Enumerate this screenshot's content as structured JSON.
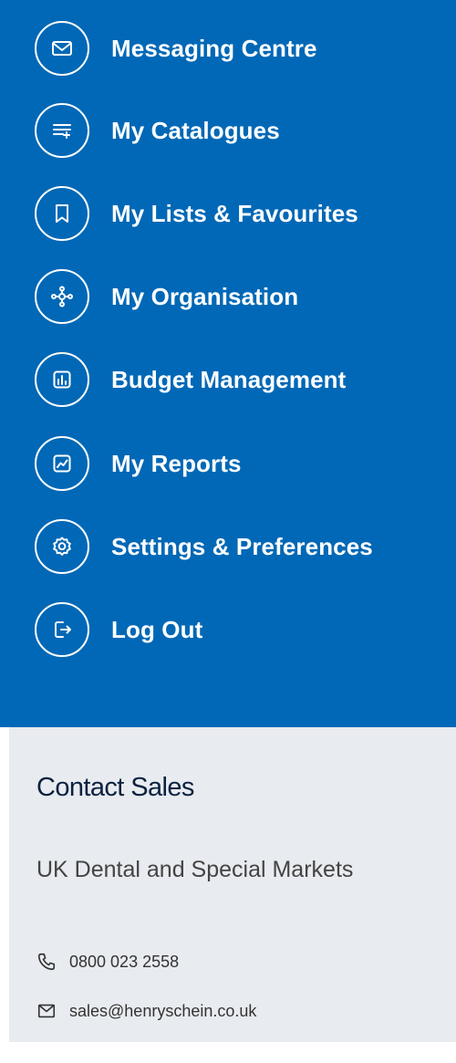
{
  "menu": {
    "background": "#0068b6",
    "items": [
      {
        "label": "Messaging Centre",
        "icon": "envelope-icon"
      },
      {
        "label": "My Catalogues",
        "icon": "catalogue-list-icon"
      },
      {
        "label": "My Lists & Favourites",
        "icon": "bookmark-icon"
      },
      {
        "label": "My Organisation",
        "icon": "organisation-network-icon"
      },
      {
        "label": "Budget Management",
        "icon": "bar-chart-icon"
      },
      {
        "label": "My Reports",
        "icon": "line-chart-icon"
      },
      {
        "label": "Settings & Preferences",
        "icon": "gear-icon"
      },
      {
        "label": "Log Out",
        "icon": "logout-icon"
      }
    ]
  },
  "contact": {
    "background": "#e8ebef",
    "title": "Contact Sales",
    "department": "UK Dental and Special Markets",
    "phone": "0800 023 2558",
    "email": "sales@henryschein.co.uk"
  }
}
